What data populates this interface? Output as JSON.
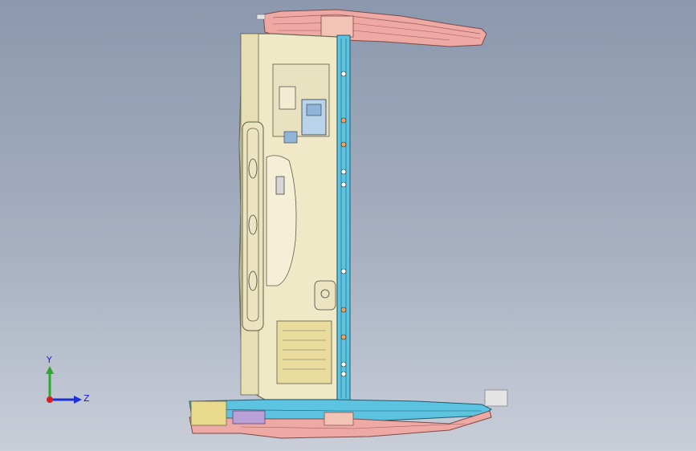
{
  "viewport": {
    "triad": {
      "y_label": "Y",
      "z_label": "Z",
      "y_color": "#2ea82e",
      "z_color": "#1f2fd6",
      "x_color": "#d61f1f"
    }
  },
  "colors": {
    "frame_cream": "#efe9c8",
    "frame_edge": "#6a6a52",
    "rail_pink": "#eea9a5",
    "rail_blue": "#5cc4e0",
    "part_blue": "#8fc4e6",
    "part_yellow": "#e9d98a"
  }
}
